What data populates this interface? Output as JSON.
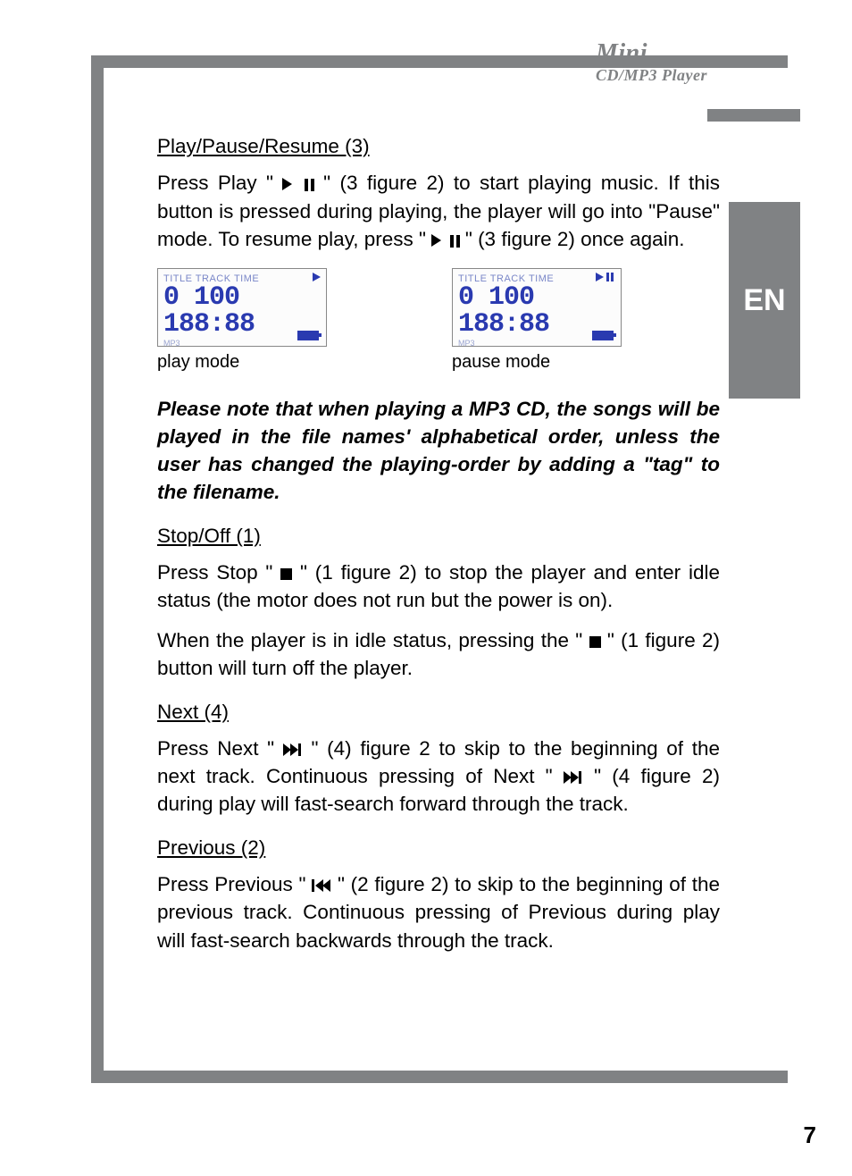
{
  "header": {
    "title": "Mini",
    "subtitle": "CD/MP3 Player"
  },
  "lang_tab": "EN",
  "page_number": "7",
  "sections": {
    "play_pause": {
      "title": "Play/Pause/Resume  (3)",
      "p1a": "Press Play \" ",
      "p1b": " \"  (3  figure 2) to start playing music. If this button is pressed during playing, the player will go into \"Pause\" mode. To resume play, press \" ",
      "p1c": " \" (3  figure 2) once again."
    },
    "lcd": {
      "top_label": "TITLE  TRACK  TIME",
      "digits": "0 100 188:88",
      "mp3": "MP3",
      "caption_play": "play mode",
      "caption_pause": "pause mode"
    },
    "note": "Please note that when playing a MP3 CD, the songs will be played in the file names' alpha­betical order, unless the user has changed the playing-order by adding a \"tag\" to the filename.",
    "stop": {
      "title": "Stop/Off  (1)",
      "p1a": "Press Stop \" ",
      "p1b": " \" (1 figure 2) to stop the player and enter idle status (the motor does not run but the power is on).",
      "p2a": "When the player is in idle status, pressing the \" ",
      "p2b": " \" (1 figure 2) button will turn off the player."
    },
    "next": {
      "title": "Next  (4)",
      "p1a": "Press Next \"",
      "p1b": "\" (4) figure 2 to skip to the beginning of the next track. Continuous pressing of Next \"",
      "p1c": "\" (4 figure 2) during play will fast-search forward through the track."
    },
    "prev": {
      "title": "Previous  (2)",
      "p1a": "Press Previous \"",
      "p1b": "\" (2 figure 2) to skip to the begin­ning of the previous track. Continuous pressing of Previous during play will fast-search backwards through the track."
    }
  }
}
